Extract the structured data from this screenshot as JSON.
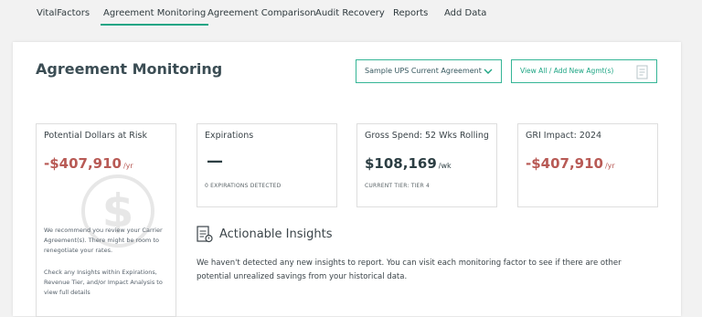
{
  "nav": {
    "items": [
      {
        "label": "VitalFactors"
      },
      {
        "label": "Agreement Monitoring",
        "active": true
      },
      {
        "label": "Agreement Comparison"
      },
      {
        "label": "Audit Recovery"
      },
      {
        "label": "Reports"
      },
      {
        "label": "Add Data"
      }
    ]
  },
  "header": {
    "title": "Agreement Monitoring",
    "agreement_select": {
      "value": "Sample UPS Current Agreement",
      "icon": "chevron-down-icon"
    },
    "view_all_button": {
      "label": "View All / Add New Agmt(s)",
      "icon": "document-icon"
    }
  },
  "cards": {
    "dollars_at_risk": {
      "title": "Potential Dollars at Risk",
      "value": "-$407,910",
      "unit": "/yr",
      "note_1": "We recommend you review your Carrier Agreement(s). There might be room to renegotiate your rates.",
      "note_2": "Check any Insights within Expirations, Revenue Tier, and/or Impact Analysis to view full details"
    },
    "expirations": {
      "title": "Expirations",
      "value": "—",
      "sub": "0 EXPIRATIONS DETECTED"
    },
    "gross_spend": {
      "title": "Gross Spend: 52 Wks Rolling",
      "value": "$108,169",
      "unit": "/wk",
      "sub": "CURRENT TIER: TIER 4"
    },
    "gri_impact": {
      "title": "GRI Impact: 2024",
      "value": "-$407,910",
      "unit": "/yr"
    }
  },
  "insights": {
    "title": "Actionable Insights",
    "text": "We haven't detected any new insights to report. You can visit each monitoring factor to see if there are other potential unrealized savings from your historical data."
  },
  "colors": {
    "accent": "#1ea584",
    "negative": "#b85a55",
    "heading": "#3b4d54"
  }
}
